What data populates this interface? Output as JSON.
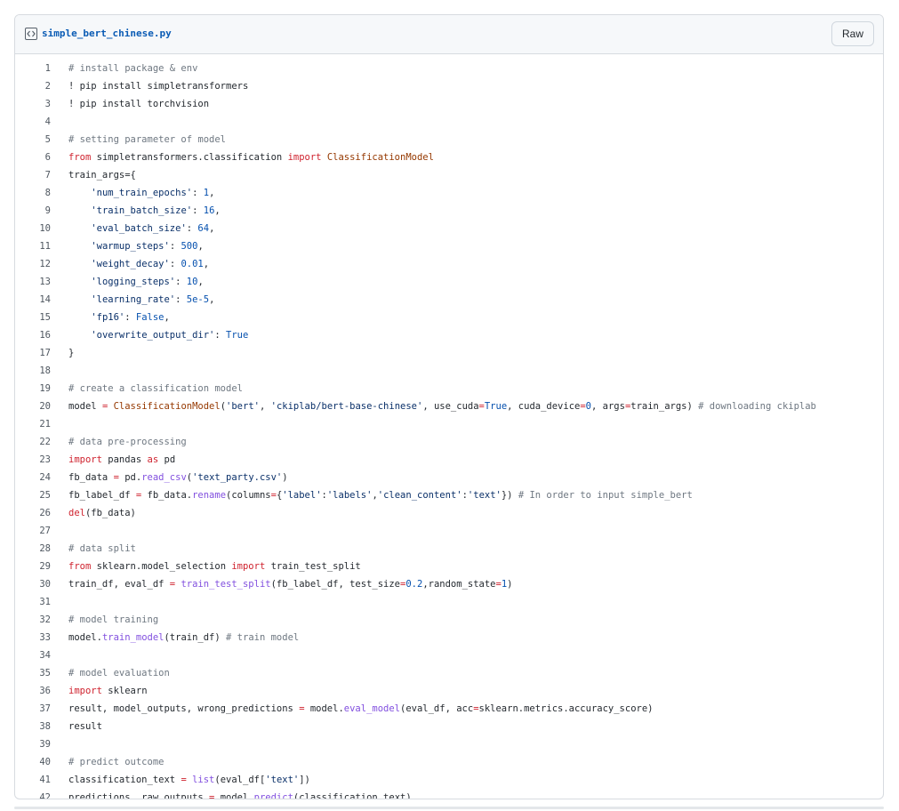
{
  "file": {
    "name": "simple_bert_chinese.py",
    "raw_label": "Raw"
  },
  "code": {
    "lines": [
      {
        "n": "1",
        "segs": [
          {
            "t": "# install package & env",
            "c": "c"
          }
        ]
      },
      {
        "n": "2",
        "segs": [
          {
            "t": "! pip install simpletransformers",
            "c": ""
          }
        ]
      },
      {
        "n": "3",
        "segs": [
          {
            "t": "! pip install torchvision",
            "c": ""
          }
        ]
      },
      {
        "n": "4",
        "segs": []
      },
      {
        "n": "5",
        "segs": [
          {
            "t": "# setting parameter of model",
            "c": "c"
          }
        ]
      },
      {
        "n": "6",
        "segs": [
          {
            "t": "from",
            "c": "k"
          },
          {
            "t": " simpletransformers.classification ",
            "c": ""
          },
          {
            "t": "import",
            "c": "k"
          },
          {
            "t": " ",
            "c": ""
          },
          {
            "t": "ClassificationModel",
            "c": "cl"
          }
        ]
      },
      {
        "n": "7",
        "segs": [
          {
            "t": "train_args={",
            "c": ""
          }
        ]
      },
      {
        "n": "8",
        "segs": [
          {
            "t": "    ",
            "c": ""
          },
          {
            "t": "'num_train_epochs'",
            "c": "s"
          },
          {
            "t": ": ",
            "c": ""
          },
          {
            "t": "1",
            "c": "n"
          },
          {
            "t": ",",
            "c": ""
          }
        ]
      },
      {
        "n": "9",
        "segs": [
          {
            "t": "    ",
            "c": ""
          },
          {
            "t": "'train_batch_size'",
            "c": "s"
          },
          {
            "t": ": ",
            "c": ""
          },
          {
            "t": "16",
            "c": "n"
          },
          {
            "t": ",",
            "c": ""
          }
        ]
      },
      {
        "n": "10",
        "segs": [
          {
            "t": "    ",
            "c": ""
          },
          {
            "t": "'eval_batch_size'",
            "c": "s"
          },
          {
            "t": ": ",
            "c": ""
          },
          {
            "t": "64",
            "c": "n"
          },
          {
            "t": ",",
            "c": ""
          }
        ]
      },
      {
        "n": "11",
        "segs": [
          {
            "t": "    ",
            "c": ""
          },
          {
            "t": "'warmup_steps'",
            "c": "s"
          },
          {
            "t": ": ",
            "c": ""
          },
          {
            "t": "500",
            "c": "n"
          },
          {
            "t": ",",
            "c": ""
          }
        ]
      },
      {
        "n": "12",
        "segs": [
          {
            "t": "    ",
            "c": ""
          },
          {
            "t": "'weight_decay'",
            "c": "s"
          },
          {
            "t": ": ",
            "c": ""
          },
          {
            "t": "0.01",
            "c": "n"
          },
          {
            "t": ",",
            "c": ""
          }
        ]
      },
      {
        "n": "13",
        "segs": [
          {
            "t": "    ",
            "c": ""
          },
          {
            "t": "'logging_steps'",
            "c": "s"
          },
          {
            "t": ": ",
            "c": ""
          },
          {
            "t": "10",
            "c": "n"
          },
          {
            "t": ",",
            "c": ""
          }
        ]
      },
      {
        "n": "14",
        "segs": [
          {
            "t": "    ",
            "c": ""
          },
          {
            "t": "'learning_rate'",
            "c": "s"
          },
          {
            "t": ": ",
            "c": ""
          },
          {
            "t": "5e-5",
            "c": "n"
          },
          {
            "t": ",",
            "c": ""
          }
        ]
      },
      {
        "n": "15",
        "segs": [
          {
            "t": "    ",
            "c": ""
          },
          {
            "t": "'fp16'",
            "c": "s"
          },
          {
            "t": ": ",
            "c": ""
          },
          {
            "t": "False",
            "c": "n"
          },
          {
            "t": ",",
            "c": ""
          }
        ]
      },
      {
        "n": "16",
        "segs": [
          {
            "t": "    ",
            "c": ""
          },
          {
            "t": "'overwrite_output_dir'",
            "c": "s"
          },
          {
            "t": ": ",
            "c": ""
          },
          {
            "t": "True",
            "c": "n"
          }
        ]
      },
      {
        "n": "17",
        "segs": [
          {
            "t": "}",
            "c": ""
          }
        ]
      },
      {
        "n": "18",
        "segs": []
      },
      {
        "n": "19",
        "segs": [
          {
            "t": "# create a classification model",
            "c": "c"
          }
        ]
      },
      {
        "n": "20",
        "segs": [
          {
            "t": "model ",
            "c": ""
          },
          {
            "t": "=",
            "c": "k"
          },
          {
            "t": " ",
            "c": ""
          },
          {
            "t": "ClassificationModel",
            "c": "cl"
          },
          {
            "t": "(",
            "c": ""
          },
          {
            "t": "'bert'",
            "c": "s"
          },
          {
            "t": ", ",
            "c": ""
          },
          {
            "t": "'ckiplab/bert-base-chinese'",
            "c": "s"
          },
          {
            "t": ", use_cuda",
            "c": ""
          },
          {
            "t": "=",
            "c": "k"
          },
          {
            "t": "True",
            "c": "n"
          },
          {
            "t": ", cuda_device",
            "c": ""
          },
          {
            "t": "=",
            "c": "k"
          },
          {
            "t": "0",
            "c": "n"
          },
          {
            "t": ", args",
            "c": ""
          },
          {
            "t": "=",
            "c": "k"
          },
          {
            "t": "train_args) ",
            "c": ""
          },
          {
            "t": "# downloading ckiplab",
            "c": "c"
          }
        ]
      },
      {
        "n": "21",
        "segs": []
      },
      {
        "n": "22",
        "segs": [
          {
            "t": "# data pre-processing",
            "c": "c"
          }
        ]
      },
      {
        "n": "23",
        "segs": [
          {
            "t": "import",
            "c": "k"
          },
          {
            "t": " pandas ",
            "c": ""
          },
          {
            "t": "as",
            "c": "k"
          },
          {
            "t": " pd",
            "c": ""
          }
        ]
      },
      {
        "n": "24",
        "segs": [
          {
            "t": "fb_data ",
            "c": ""
          },
          {
            "t": "=",
            "c": "k"
          },
          {
            "t": " pd.",
            "c": ""
          },
          {
            "t": "read_csv",
            "c": "f"
          },
          {
            "t": "(",
            "c": ""
          },
          {
            "t": "'text_party.csv'",
            "c": "s"
          },
          {
            "t": ")",
            "c": ""
          }
        ]
      },
      {
        "n": "25",
        "segs": [
          {
            "t": "fb_label_df ",
            "c": ""
          },
          {
            "t": "=",
            "c": "k"
          },
          {
            "t": " fb_data.",
            "c": ""
          },
          {
            "t": "rename",
            "c": "f"
          },
          {
            "t": "(columns",
            "c": ""
          },
          {
            "t": "=",
            "c": "k"
          },
          {
            "t": "{",
            "c": ""
          },
          {
            "t": "'label'",
            "c": "s"
          },
          {
            "t": ":",
            "c": ""
          },
          {
            "t": "'labels'",
            "c": "s"
          },
          {
            "t": ",",
            "c": ""
          },
          {
            "t": "'clean_content'",
            "c": "s"
          },
          {
            "t": ":",
            "c": ""
          },
          {
            "t": "'text'",
            "c": "s"
          },
          {
            "t": "}) ",
            "c": ""
          },
          {
            "t": "# In order to input simple_bert",
            "c": "c"
          }
        ]
      },
      {
        "n": "26",
        "segs": [
          {
            "t": "del",
            "c": "k"
          },
          {
            "t": "(fb_data)",
            "c": ""
          }
        ]
      },
      {
        "n": "27",
        "segs": []
      },
      {
        "n": "28",
        "segs": [
          {
            "t": "# data split",
            "c": "c"
          }
        ]
      },
      {
        "n": "29",
        "segs": [
          {
            "t": "from",
            "c": "k"
          },
          {
            "t": " sklearn.model_selection ",
            "c": ""
          },
          {
            "t": "import",
            "c": "k"
          },
          {
            "t": " train_test_split",
            "c": ""
          }
        ]
      },
      {
        "n": "30",
        "segs": [
          {
            "t": "train_df, eval_df ",
            "c": ""
          },
          {
            "t": "=",
            "c": "k"
          },
          {
            "t": " ",
            "c": ""
          },
          {
            "t": "train_test_split",
            "c": "f"
          },
          {
            "t": "(fb_label_df, test_size",
            "c": ""
          },
          {
            "t": "=",
            "c": "k"
          },
          {
            "t": "0.2",
            "c": "n"
          },
          {
            "t": ",random_state",
            "c": ""
          },
          {
            "t": "=",
            "c": "k"
          },
          {
            "t": "1",
            "c": "n"
          },
          {
            "t": ")",
            "c": ""
          }
        ]
      },
      {
        "n": "31",
        "segs": []
      },
      {
        "n": "32",
        "segs": [
          {
            "t": "# model training",
            "c": "c"
          }
        ]
      },
      {
        "n": "33",
        "segs": [
          {
            "t": "model.",
            "c": ""
          },
          {
            "t": "train_model",
            "c": "f"
          },
          {
            "t": "(train_df) ",
            "c": ""
          },
          {
            "t": "# train model",
            "c": "c"
          }
        ]
      },
      {
        "n": "34",
        "segs": []
      },
      {
        "n": "35",
        "segs": [
          {
            "t": "# model evaluation",
            "c": "c"
          }
        ]
      },
      {
        "n": "36",
        "segs": [
          {
            "t": "import",
            "c": "k"
          },
          {
            "t": " sklearn",
            "c": ""
          }
        ]
      },
      {
        "n": "37",
        "segs": [
          {
            "t": "result, model_outputs, wrong_predictions ",
            "c": ""
          },
          {
            "t": "=",
            "c": "k"
          },
          {
            "t": " model.",
            "c": ""
          },
          {
            "t": "eval_model",
            "c": "f"
          },
          {
            "t": "(eval_df, acc",
            "c": ""
          },
          {
            "t": "=",
            "c": "k"
          },
          {
            "t": "sklearn.metrics.accuracy_score)",
            "c": ""
          }
        ]
      },
      {
        "n": "38",
        "segs": [
          {
            "t": "result",
            "c": ""
          }
        ]
      },
      {
        "n": "39",
        "segs": []
      },
      {
        "n": "40",
        "segs": [
          {
            "t": "# predict outcome",
            "c": "c"
          }
        ]
      },
      {
        "n": "41",
        "segs": [
          {
            "t": "classification_text ",
            "c": ""
          },
          {
            "t": "=",
            "c": "k"
          },
          {
            "t": " ",
            "c": ""
          },
          {
            "t": "list",
            "c": "f"
          },
          {
            "t": "(eval_df[",
            "c": ""
          },
          {
            "t": "'text'",
            "c": "s"
          },
          {
            "t": "])",
            "c": ""
          }
        ]
      },
      {
        "n": "42",
        "segs": [
          {
            "t": "predictions, raw_outputs ",
            "c": ""
          },
          {
            "t": "=",
            "c": "k"
          },
          {
            "t": " model.",
            "c": ""
          },
          {
            "t": "predict",
            "c": "f"
          },
          {
            "t": "(classification_text)",
            "c": ""
          }
        ]
      }
    ]
  },
  "icons": {
    "file_type": "code-square-icon"
  },
  "colors": {
    "comment": "#6e7781",
    "keyword": "#cf222e",
    "string": "#0a3069",
    "number": "#0550ae",
    "function": "#8250df",
    "class": "#953800",
    "filename": "#0b5cb5"
  }
}
